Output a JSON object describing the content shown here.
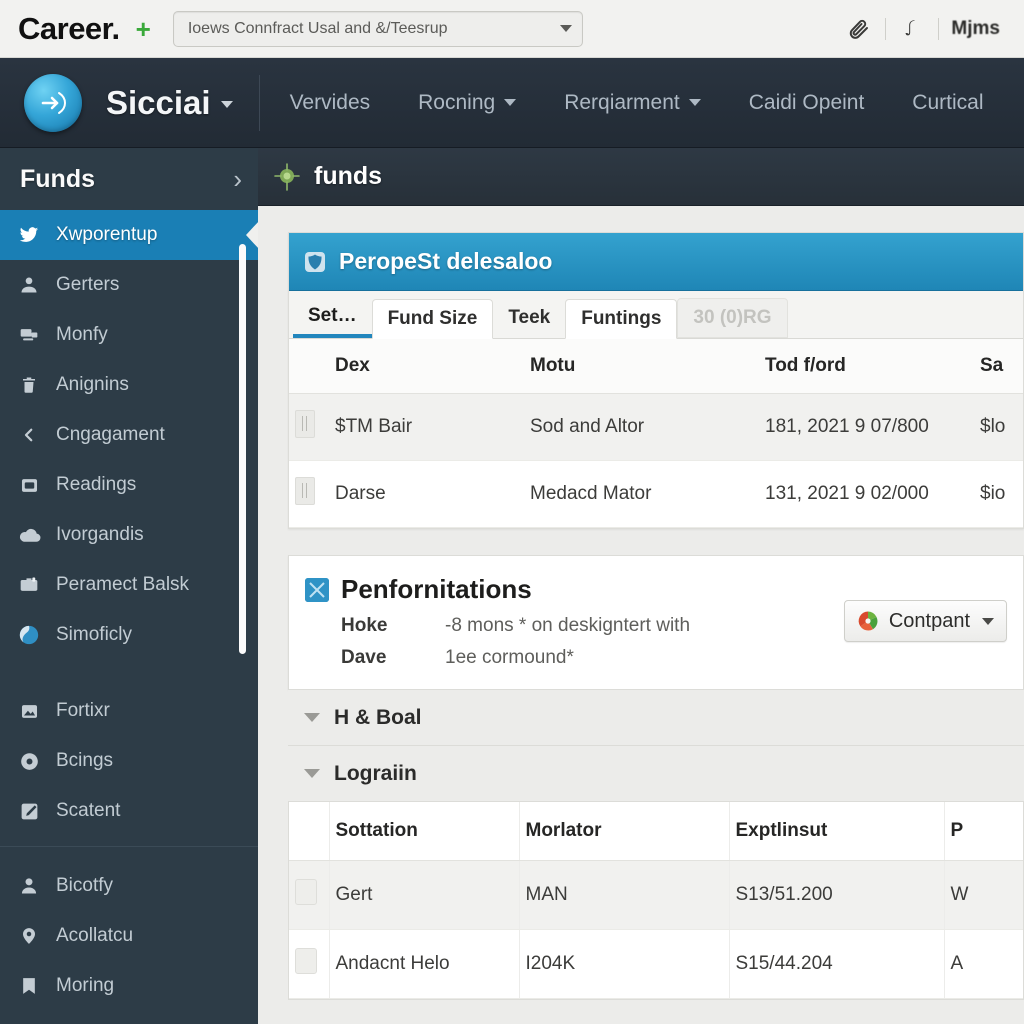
{
  "titlebar": {
    "brand": "Career.",
    "add_label": "+",
    "address": {
      "value": "Ioews Connfract Usal and &/Teesrup",
      "placeholder": "Ioews Connfract Usal and &/Teesrup"
    },
    "icons": [
      "paperclip-icon",
      "bookmark-icon"
    ],
    "user_label": "Mjms"
  },
  "navbar": {
    "logo": "arrow-circle-logo",
    "brand": "Sicciai",
    "items": [
      {
        "label": "Vervides",
        "caret": false
      },
      {
        "label": "Rocning",
        "caret": true
      },
      {
        "label": "Rerqiarment",
        "caret": true
      },
      {
        "label": "Caidi Opeint",
        "caret": false
      },
      {
        "label": "Curtical",
        "caret": false
      }
    ]
  },
  "sidebar": {
    "header": {
      "title": "Funds",
      "arrow": "›"
    },
    "items": [
      {
        "label": "Xwporentup",
        "icon": "bird-icon",
        "active": true
      },
      {
        "label": "Gerters",
        "icon": "user-icon",
        "active": false
      },
      {
        "label": "Monfy",
        "icon": "screen-icon",
        "active": false
      },
      {
        "label": "Anignins",
        "icon": "trash-icon",
        "active": false
      },
      {
        "label": "Cngagament",
        "icon": "chevron-left-icon",
        "active": false
      },
      {
        "label": "Readings",
        "icon": "inbox-icon",
        "active": false
      },
      {
        "label": "Ivorgandis",
        "icon": "cloud-icon",
        "active": false
      },
      {
        "label": "Peramect Balsk",
        "icon": "briefcase-icon",
        "active": false
      },
      {
        "label": "Simoficly",
        "icon": "globe-icon",
        "active": false
      }
    ],
    "items2": [
      {
        "label": "Fortixr",
        "icon": "image-icon",
        "active": false
      },
      {
        "label": "Bcings",
        "icon": "gear-icon",
        "active": false
      },
      {
        "label": "Scatent",
        "icon": "edit-icon",
        "active": false
      }
    ],
    "items3": [
      {
        "label": "Bicotfy",
        "icon": "person-icon",
        "active": false
      },
      {
        "label": "Acollatcu",
        "icon": "map-pin-icon",
        "active": false
      },
      {
        "label": "Moring",
        "icon": "bookmark-icon",
        "active": false
      }
    ]
  },
  "main": {
    "topbar": {
      "icon": "compass-icon",
      "title": "funds"
    },
    "panel": {
      "header": {
        "icon": "shield-icon",
        "title": "PeropeSt delesaloo"
      },
      "tabs": [
        {
          "label": "Set…",
          "style": "underline"
        },
        {
          "label": "Fund Size",
          "style": "boxed"
        },
        {
          "label": "Teek",
          "style": "plain"
        },
        {
          "label": "Funtings",
          "style": "boxed"
        },
        {
          "label": "30 (0)RG",
          "style": "dim"
        }
      ],
      "table": {
        "columns": [
          "",
          "Dex",
          "Motu",
          "Tod f/ord",
          "Sa"
        ],
        "rows": [
          {
            "handle": "row-handle",
            "cells": [
              "$TM Bair",
              "Sod and Altor",
              "181, 2021 9 07/800",
              "$lo"
            ]
          },
          {
            "handle": "row-handle",
            "cells": [
              "Darse",
              "Medacd Mator",
              "131, 2021 9 02/000",
              "$io"
            ]
          }
        ]
      }
    },
    "performance": {
      "icon": "chart-icon",
      "title": "Penfornitations",
      "rows": [
        {
          "key": "Hoke",
          "value": "-8 mons * on deskigntert with"
        },
        {
          "key": "Dave",
          "value": "1ee cormound*"
        }
      ],
      "button": {
        "icon": "colorwheel-icon",
        "label": "Contpant",
        "caret": "▼"
      }
    },
    "accordions": [
      {
        "label": "H & Boal",
        "expanded": true
      },
      {
        "label": "Lograiin",
        "expanded": true
      }
    ],
    "bottom_table": {
      "columns": [
        "",
        "Sottation",
        "Morlator",
        "Exptlinsut",
        "P"
      ],
      "rows": [
        {
          "handle": "sq-handle",
          "cells": [
            "Gert",
            "MAN",
            "S13/51.200",
            "W"
          ]
        },
        {
          "handle": "sq-handle",
          "cells": [
            "Andacnt Helo",
            "I204K",
            "S15/44.204",
            "A"
          ]
        }
      ]
    }
  },
  "colors": {
    "accent_blue": "#1a7fb5",
    "panel_blue": "#2286bd",
    "nav_dark": "#2a3440",
    "sidebar_dark": "#2d3c47",
    "green_plus": "#3aa93a"
  }
}
